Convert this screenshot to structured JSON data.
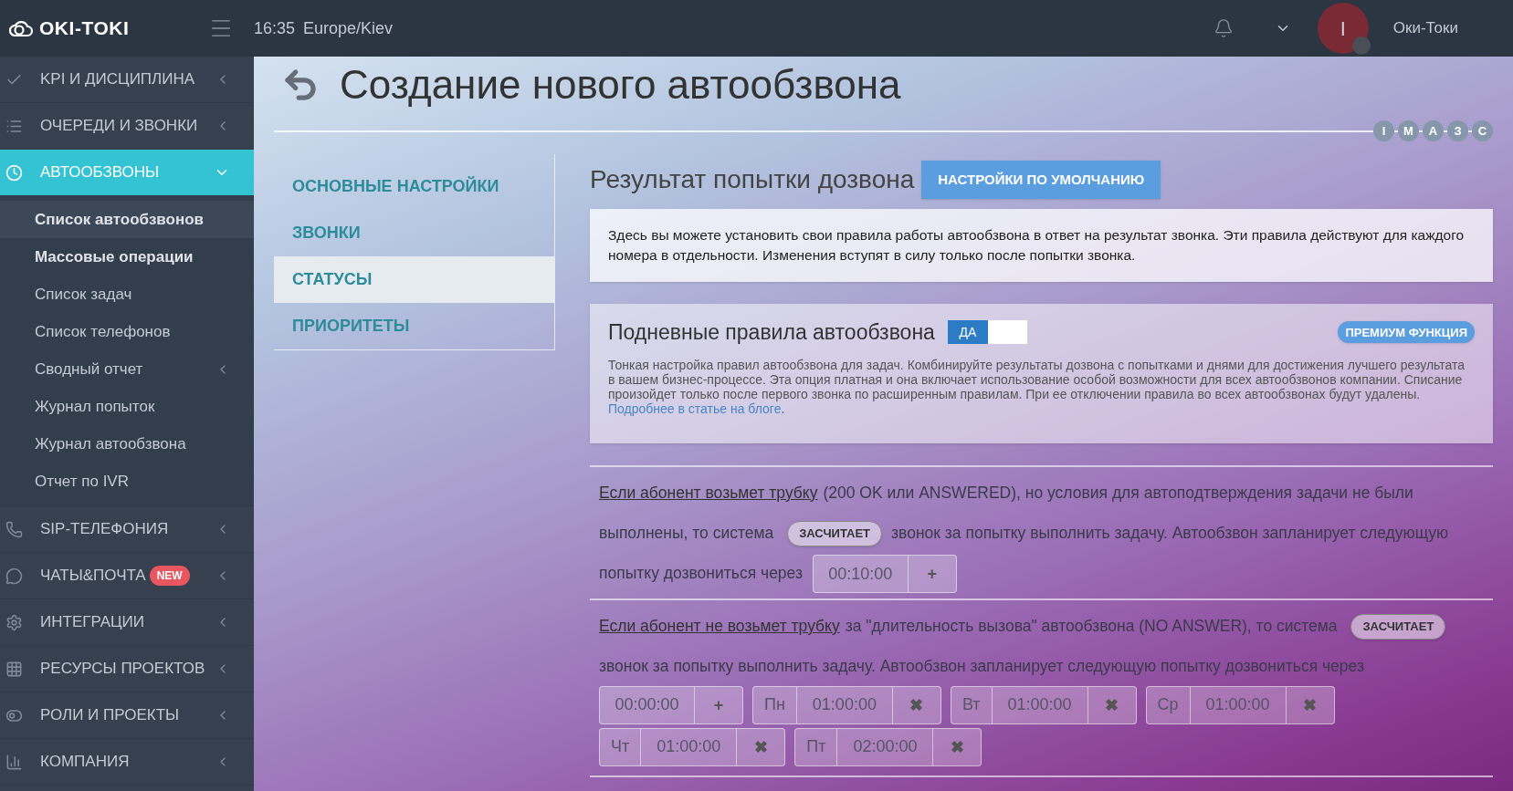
{
  "header": {
    "logo": "OKI-TOKI",
    "time": "16:35",
    "timezone": "Europe/Kiev",
    "avatar_letter": "I",
    "user": "Оки-Токи"
  },
  "sidebar": {
    "items": [
      {
        "label": "KPI И ДИСЦИПЛИНА",
        "expanded": false,
        "selected": false
      },
      {
        "label": "ОЧЕРЕДИ И ЗВОНКИ",
        "expanded": false,
        "selected": false
      },
      {
        "label": "АВТООБЗВОНЫ",
        "expanded": true,
        "selected": true,
        "children": [
          {
            "label": "Список автообзвонов",
            "selected": true,
            "emphasized": true,
            "expandable": false
          },
          {
            "label": "Массовые операции",
            "selected": false,
            "emphasized": true,
            "expandable": false
          },
          {
            "label": "Список задач",
            "selected": false,
            "emphasized": false,
            "expandable": false
          },
          {
            "label": "Список телефонов",
            "selected": false,
            "emphasized": false,
            "expandable": false
          },
          {
            "label": "Сводный отчет",
            "selected": false,
            "emphasized": false,
            "expandable": true
          },
          {
            "label": "Журнал попыток",
            "selected": false,
            "emphasized": false,
            "expandable": false
          },
          {
            "label": "Журнал автообзвона",
            "selected": false,
            "emphasized": false,
            "expandable": false
          },
          {
            "label": "Отчет по IVR",
            "selected": false,
            "emphasized": false,
            "expandable": false
          }
        ]
      },
      {
        "label": "SIP-ТЕЛЕФОНИЯ",
        "expanded": false,
        "selected": false
      },
      {
        "label": "ЧАТЫ&ПОЧТА",
        "badge": "NEW",
        "expanded": false,
        "selected": false
      },
      {
        "label": "ИНТЕГРАЦИИ",
        "expanded": false,
        "selected": false
      },
      {
        "label": "РЕСУРСЫ ПРОЕКТОВ",
        "expanded": false,
        "selected": false
      },
      {
        "label": "РОЛИ И ПРОЕКТЫ",
        "expanded": false,
        "selected": false
      },
      {
        "label": "КОМПАНИЯ",
        "expanded": false,
        "selected": false
      }
    ]
  },
  "page": {
    "title": "Создание нового автообзвона",
    "steps": [
      "I",
      "М",
      "А",
      "З",
      "С"
    ]
  },
  "tabs": [
    {
      "label": "ОСНОВНЫЕ НАСТРОЙКИ",
      "selected": false
    },
    {
      "label": "ЗВОНКИ",
      "selected": false
    },
    {
      "label": "СТАТУСЫ",
      "selected": true
    },
    {
      "label": "ПРИОРИТЕТЫ",
      "selected": false
    }
  ],
  "section": {
    "title": "Результат попытки дозвона",
    "default_button": "НАСТРОЙКИ ПО УМОЛЧАНИЮ",
    "info": "Здесь вы можете установить свои правила работы автообзвона в ответ на результат звонка. Эти правила действуют для каждого номера в отдельности. Изменения вступят в силу только после попытки звонка."
  },
  "premium": {
    "title": "Подневные правила автообзвона",
    "toggle": {
      "label": "ДА",
      "on": true
    },
    "badge": "ПРЕМИУМ ФУНКЦИЯ",
    "description": "Тонкая настройка правил автообзвона для задач. Комбинируйте результаты дозвона с попытками и днями для достижения лучшего результата в вашем бизнес-процессе. Эта опция платная и она включает использование особой возможности для всех автообзвонов компании. Списание произойдет только после первого звонка по расширенным правилам. При ее отключении правила во всех автообзвонах будут удалены.",
    "link": "Подробнее в статье на блоге",
    "link_after": "."
  },
  "rules": [
    {
      "parts": [
        {
          "kind": "link",
          "text": "Если абонент возьмет трубку"
        },
        {
          "kind": "text",
          "text": "(200 OK или ANSWERED), но условия для автоподтверждения задачи не были выполнены, то система"
        },
        {
          "kind": "pill",
          "text": "ЗАСЧИТАЕТ"
        },
        {
          "kind": "text",
          "text": "звонок за попытку выполнить задачу. Автообзвон запланирует следующую попытку дозвониться через"
        },
        {
          "kind": "delay",
          "value": "00:10:00",
          "button": "+"
        }
      ]
    },
    {
      "parts": [
        {
          "kind": "link",
          "text": "Если абонент не возьмет трубку"
        },
        {
          "kind": "text",
          "text": "за \"длительность вызова\" автообзвона (NO ANSWER), то система"
        },
        {
          "kind": "pill",
          "text": "ЗАСЧИТАЕТ"
        },
        {
          "kind": "text",
          "text": "звонок за попытку выполнить задачу. Автообзвон запланирует следующую попытку дозвониться через"
        }
      ],
      "delays": [
        {
          "value": "00:00:00",
          "button": "+"
        },
        {
          "day": "Пн",
          "value": "01:00:00",
          "button": "✖"
        },
        {
          "day": "Вт",
          "value": "01:00:00",
          "button": "✖"
        },
        {
          "day": "Ср",
          "value": "01:00:00",
          "button": "✖"
        },
        {
          "day": "Чт",
          "value": "01:00:00",
          "button": "✖"
        },
        {
          "day": "Пт",
          "value": "02:00:00",
          "button": "✖"
        }
      ]
    }
  ]
}
